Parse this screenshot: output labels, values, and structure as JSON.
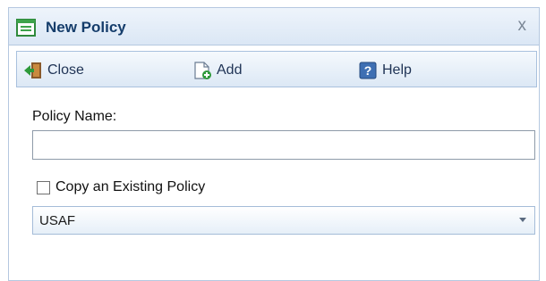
{
  "dialog": {
    "title": "New Policy",
    "close_glyph": "x",
    "title_icon": "form-icon"
  },
  "toolbar": {
    "close_label": "Close",
    "add_label": "Add",
    "help_label": "Help",
    "close_icon": "exit-icon",
    "add_icon": "add-document-icon",
    "help_icon": "help-icon"
  },
  "form": {
    "policy_name_label": "Policy Name:",
    "policy_name_value": "",
    "copy_checkbox_label": "Copy an Existing Policy",
    "copy_checked": false,
    "policy_select_value": "USAF"
  },
  "colors": {
    "title_text": "#153d6b",
    "toolbar_border": "#a9c1de",
    "dialog_border": "#b5c8e0"
  }
}
